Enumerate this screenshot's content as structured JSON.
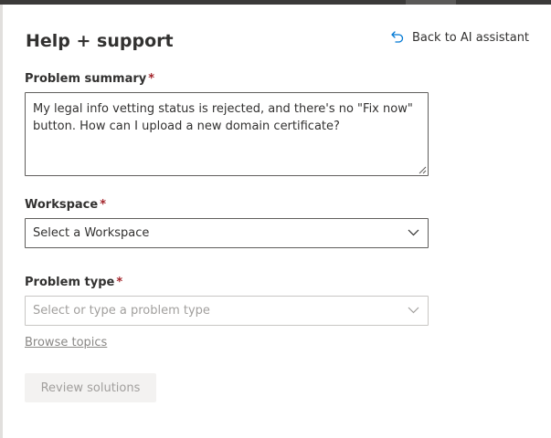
{
  "panel": {
    "title": "Help + support",
    "back_link_label": "Back to AI assistant"
  },
  "form": {
    "problem_summary": {
      "label": "Problem summary",
      "required_mark": "*",
      "value": "My legal info vetting status is rejected, and there's no \"Fix now\" button. How can I upload a new domain certificate?"
    },
    "workspace": {
      "label": "Workspace",
      "required_mark": "*",
      "selected": "Select a Workspace"
    },
    "problem_type": {
      "label": "Problem type",
      "required_mark": "*",
      "placeholder": "Select or type a problem type"
    },
    "browse_topics_label": "Browse topics",
    "review_button_label": "Review solutions"
  },
  "colors": {
    "required": "#a4262c",
    "border": "#605e5c",
    "disabled_bg": "#f3f2f1",
    "disabled_text": "#a19f9d",
    "accent": "#0078d4"
  },
  "icons": {
    "back": "undo-arrow-icon",
    "dropdown": "chevron-down-icon"
  }
}
